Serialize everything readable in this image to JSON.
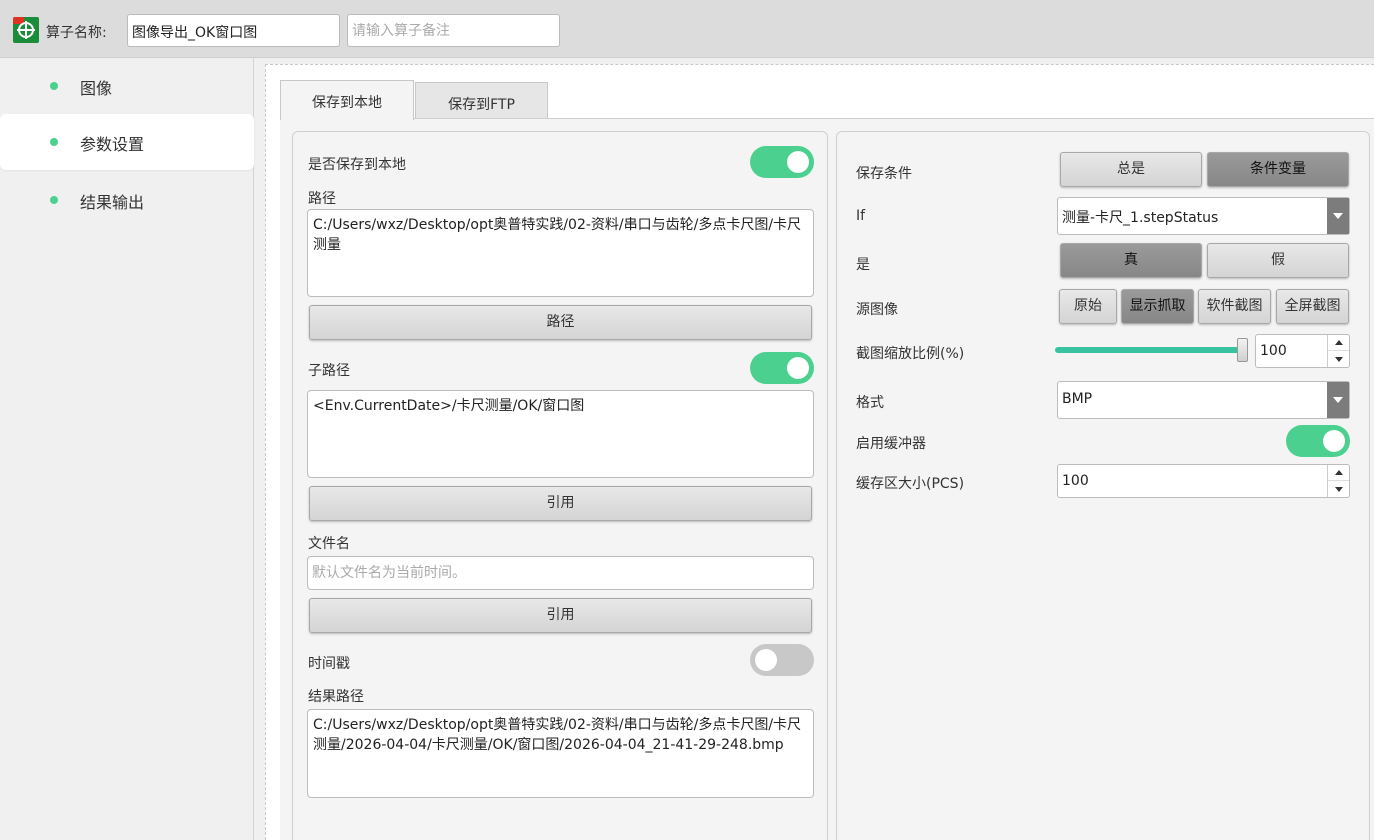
{
  "header": {
    "operator_label": "算子名称:",
    "operator_name": "图像导出_OK窗口图",
    "note_placeholder": "请输入算子备注"
  },
  "sidebar": {
    "items": [
      {
        "label": "图像"
      },
      {
        "label": "参数设置",
        "active": true
      },
      {
        "label": "结果输出"
      }
    ]
  },
  "tabs": [
    {
      "label": "保存到本地",
      "active": true
    },
    {
      "label": "保存到FTP"
    }
  ],
  "local": {
    "save_local_label": "是否保存到本地",
    "save_local_on": true,
    "path_label": "路径",
    "path_value": "C:/Users/wxz/Desktop/opt奥普特实践/02-资料/串口与齿轮/多点卡尺图/卡尺测量",
    "path_button": "路径",
    "subpath_label": "子路径",
    "subpath_on": true,
    "subpath_value": "<Env.CurrentDate>/卡尺测量/OK/窗口图",
    "subpath_button": "引用",
    "filename_label": "文件名",
    "filename_placeholder": "默认文件名为当前时间。",
    "filename_button": "引用",
    "timestamp_label": "时间戳",
    "timestamp_on": false,
    "result_path_label": "结果路径",
    "result_path_value": "C:/Users/wxz/Desktop/opt奥普特实践/02-资料/串口与齿轮/多点卡尺图/卡尺测量/2026-04-04/卡尺测量/OK/窗口图/2026-04-04_21-41-29-248.bmp"
  },
  "right": {
    "save_condition_label": "保存条件",
    "condition_options": [
      "总是",
      "条件变量"
    ],
    "condition_selected": "条件变量",
    "if_label": "If",
    "if_value": "测量-卡尺_1.stepStatus",
    "is_label": "是",
    "is_options": [
      "真",
      "假"
    ],
    "is_selected": "真",
    "source_label": "源图像",
    "source_options": [
      "原始",
      "显示抓取",
      "软件截图",
      "全屏截图"
    ],
    "source_selected": "显示抓取",
    "scale_label": "截图缩放比例(%)",
    "scale_value": "100",
    "scale_fraction": 1.0,
    "format_label": "格式",
    "format_value": "BMP",
    "buffer_label": "启用缓冲器",
    "buffer_on": true,
    "cache_label": "缓存区大小(PCS)",
    "cache_value": "100"
  },
  "colors": {
    "accent_green": "#4cd08f",
    "slider_teal": "#38c2a0"
  }
}
